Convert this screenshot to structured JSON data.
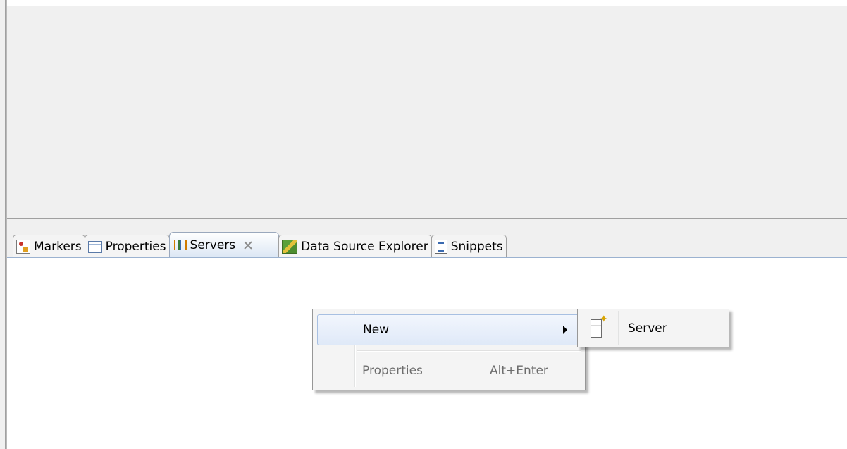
{
  "tabs": [
    {
      "label": "Markers",
      "icon": "markers-icon"
    },
    {
      "label": "Properties",
      "icon": "properties-icon"
    },
    {
      "label": "Servers",
      "icon": "servers-icon",
      "active": true
    },
    {
      "label": "Data Source Explorer",
      "icon": "data-source-explorer-icon"
    },
    {
      "label": "Snippets",
      "icon": "snippets-icon"
    }
  ],
  "context_menu": {
    "new_label": "New",
    "properties_label": "Properties",
    "properties_accelerator": "Alt+Enter"
  },
  "submenu": {
    "server_label": "Server",
    "server_icon": "new-server-icon"
  },
  "colors": {
    "active_tab_bottom": "#dbe6f4",
    "menu_highlight_border": "#a8c0e2",
    "disabled_text": "#6d6d6d"
  }
}
